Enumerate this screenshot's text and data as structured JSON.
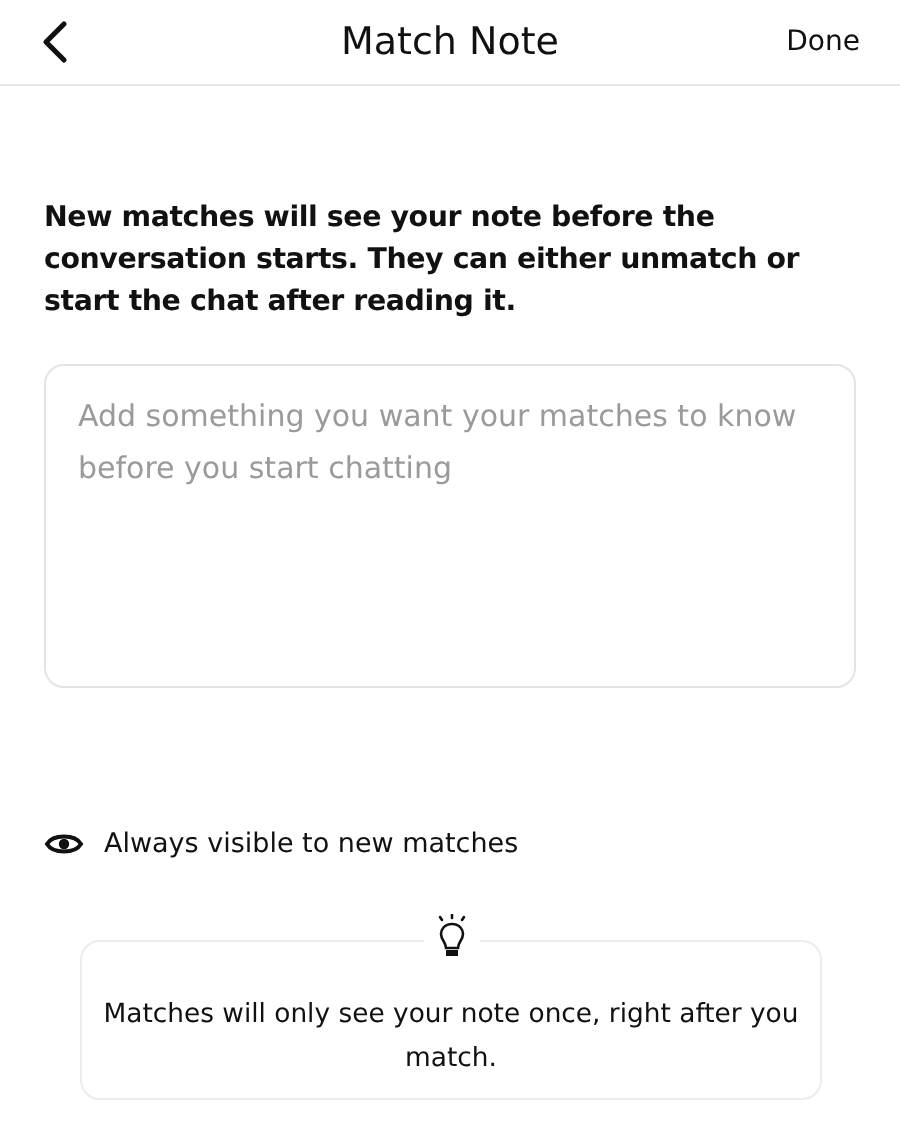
{
  "header": {
    "title": "Match Note",
    "done": "Done"
  },
  "intro": "New matches will see your note before the conversation starts. They can either unmatch or start the chat after reading it.",
  "note": {
    "placeholder": "Add something you want your matches to know before you start chatting"
  },
  "visibility": {
    "label": "Always visible to new matches"
  },
  "tip": {
    "text": "Matches will only see your note once, right after you match."
  }
}
